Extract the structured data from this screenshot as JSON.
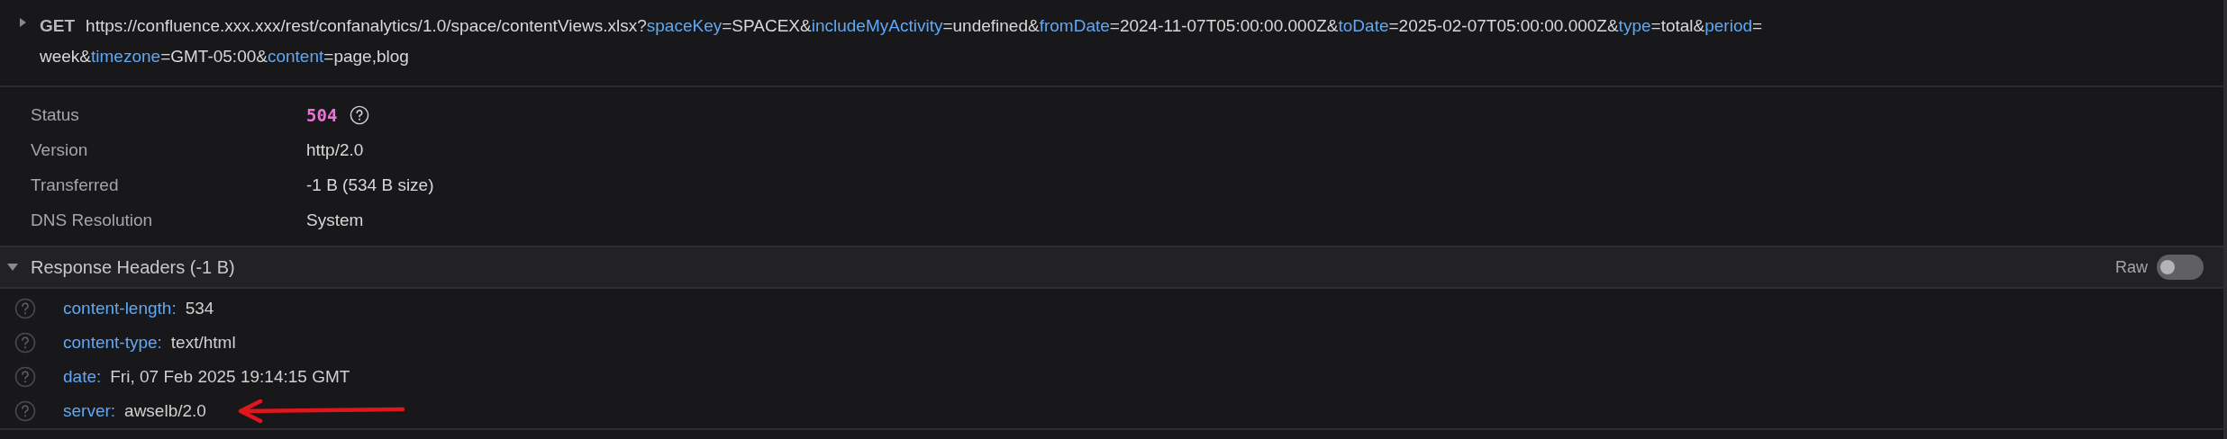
{
  "request": {
    "expanded": false,
    "method": "GET",
    "url_lines": [
      [
        {
          "kind": "plain",
          "text": "https://confluence.xxx.xxx/rest/confanalytics/1.0/space/contentViews.xlsx?"
        },
        {
          "kind": "key",
          "text": "spaceKey"
        },
        {
          "kind": "plain",
          "text": "=SPACEX&"
        },
        {
          "kind": "key",
          "text": "includeMyActivity"
        },
        {
          "kind": "plain",
          "text": "=undefined&"
        },
        {
          "kind": "key",
          "text": "fromDate"
        },
        {
          "kind": "plain",
          "text": "=2024-11-07T05:00:00.000Z&"
        },
        {
          "kind": "key",
          "text": "toDate"
        },
        {
          "kind": "plain",
          "text": "=2025-02-07T05:00:00.000Z&"
        },
        {
          "kind": "key",
          "text": "type"
        },
        {
          "kind": "plain",
          "text": "=total&"
        },
        {
          "kind": "key",
          "text": "period"
        },
        {
          "kind": "plain",
          "text": "="
        }
      ],
      [
        {
          "kind": "plain",
          "text": "week&"
        },
        {
          "kind": "key",
          "text": "timezone"
        },
        {
          "kind": "plain",
          "text": "=GMT-05:00&"
        },
        {
          "kind": "key",
          "text": "content"
        },
        {
          "kind": "plain",
          "text": "=page,blog"
        }
      ]
    ]
  },
  "summary": [
    {
      "label": "Status",
      "value": "504",
      "kind": "status"
    },
    {
      "label": "Version",
      "value": "http/2.0",
      "kind": "text"
    },
    {
      "label": "Transferred",
      "value": "-1 B (534 B size)",
      "kind": "text"
    },
    {
      "label": "DNS Resolution",
      "value": "System",
      "kind": "text"
    }
  ],
  "response_headers": {
    "title": "Response Headers (-1 B)",
    "expanded": true,
    "raw_toggle": {
      "label": "Raw",
      "on": false
    },
    "rows": [
      {
        "name": "content-length:",
        "value": "534"
      },
      {
        "name": "content-type:",
        "value": "text/html"
      },
      {
        "name": "date:",
        "value": "Fri, 07 Feb 2025 19:14:15 GMT"
      },
      {
        "name": "server:",
        "value": "awselb/2.0"
      }
    ]
  }
}
